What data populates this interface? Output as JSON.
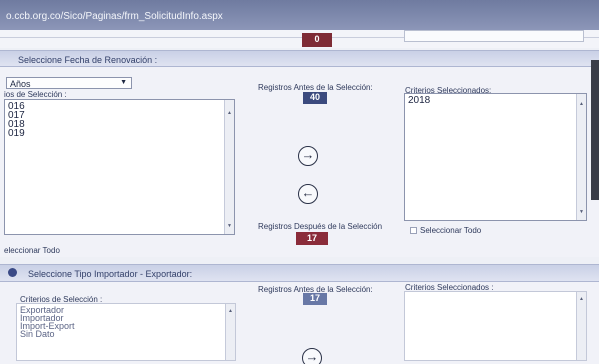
{
  "browser": {
    "url": "o.ccb.org.co/Sico/Paginas/frm_SolicitudInfo.aspx"
  },
  "top": {
    "counter": "0"
  },
  "renovacion": {
    "section_title": "Seleccione Fecha de Renovación :",
    "dropdown_value": "Años",
    "criteria_label": "ios de Selección :",
    "options": [
      "016",
      "017",
      "018",
      "019"
    ],
    "select_all": "eleccionar Todo",
    "before_label": "Registros Antes de la Selección:",
    "before_count": "40",
    "after_label": "Registros Después de la Selección",
    "after_count": "17",
    "selected_label": "Criterios Seleccionados:",
    "selected_items": [
      "2018"
    ],
    "select_all_right": "Seleccionar Todo"
  },
  "importador": {
    "section_title": "Seleccione Tipo Importador - Exportador:",
    "criteria_label": "Criterios de Selección :",
    "options": [
      "Exportador",
      "Importador",
      "Import-Export",
      "Sin Dato"
    ],
    "before_label": "Registros Antes de la Selección:",
    "before_count": "17",
    "selected_label": "Criterios Seleccionados :"
  },
  "icons": {
    "move_right": "→",
    "move_left": "←",
    "dropdown": "▼",
    "scroll_up": "▲",
    "scroll_down": "▼"
  },
  "colors": {
    "counter_red": "#7e2b35",
    "counter_blue": "#3b4a7e",
    "section_band": "#c9d0e6"
  }
}
